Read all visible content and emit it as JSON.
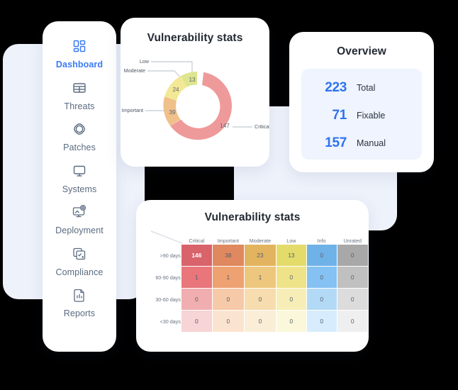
{
  "sidebar": {
    "items": [
      {
        "label": "Dashboard",
        "icon": "dashboard-grid-icon",
        "active": true
      },
      {
        "label": "Threats",
        "icon": "table-icon",
        "active": false
      },
      {
        "label": "Patches",
        "icon": "patch-knot-icon",
        "active": false
      },
      {
        "label": "Systems",
        "icon": "monitor-icon",
        "active": false
      },
      {
        "label": "Deployment",
        "icon": "deployment-icon",
        "active": false
      },
      {
        "label": "Compliance",
        "icon": "checklist-icon",
        "active": false
      },
      {
        "label": "Reports",
        "icon": "report-document-icon",
        "active": false
      }
    ],
    "active_color": "#3b7bf6",
    "label_color": "#5a6b80"
  },
  "donut_card": {
    "title": "Vulnerability stats"
  },
  "overview_card": {
    "title": "Overview",
    "rows": [
      {
        "value": "223",
        "label": "Total"
      },
      {
        "value": "71",
        "label": "Fixable"
      },
      {
        "value": "157",
        "label": "Manual"
      }
    ],
    "value_color": "#2f72f0",
    "panel_color": "#eff4fe"
  },
  "heatmap_card": {
    "title": "Vulnerability stats"
  },
  "chart_data": [
    {
      "type": "pie",
      "title": "Vulnerability stats",
      "subtype": "donut",
      "categories": [
        "Critical",
        "Important",
        "Moderate",
        "Low"
      ],
      "values": [
        147,
        39,
        24,
        13
      ],
      "labels": [
        "147",
        "39",
        "24",
        "13"
      ],
      "colors": [
        "#ef9a9a",
        "#f0c08a",
        "#f2e896",
        "#dde58f"
      ],
      "total": 223,
      "legend": "leader-line labels outside slices",
      "label_color": "#4c5663"
    },
    {
      "type": "heatmap",
      "title": "Vulnerability stats",
      "xlabel": "",
      "ylabel": "",
      "categories": [
        "Critical",
        "Important",
        "Moderate",
        "Low",
        "Info",
        "Unrated"
      ],
      "rows": [
        ">90 days",
        "60-90 days",
        "30-60 days",
        "<30 days"
      ],
      "values": [
        [
          146,
          38,
          23,
          13,
          0,
          0
        ],
        [
          1,
          1,
          1,
          0,
          0,
          0
        ],
        [
          0,
          0,
          0,
          0,
          0,
          0
        ],
        [
          0,
          0,
          0,
          0,
          0,
          0
        ]
      ],
      "cell_colors": [
        [
          "#d9636a",
          "#e0885f",
          "#e3b45f",
          "#e3dc6b",
          "#6fb2e8",
          "#a8a8a8"
        ],
        [
          "#e8767b",
          "#eea171",
          "#eec77e",
          "#efe389",
          "#85c1f2",
          "#c0c0c0"
        ],
        [
          "#f0aeb0",
          "#f6c9a8",
          "#f6dcae",
          "#f6eeb6",
          "#b2daf7",
          "#dcdcdc"
        ],
        [
          "#f7d4d5",
          "#fbe4cf",
          "#fbeed7",
          "#fbf7da",
          "#d7ecfc",
          "#efefef"
        ]
      ],
      "grid": true,
      "legend": "none",
      "header_color": "#6b7482",
      "cell_text_color": "#55606e"
    }
  ]
}
